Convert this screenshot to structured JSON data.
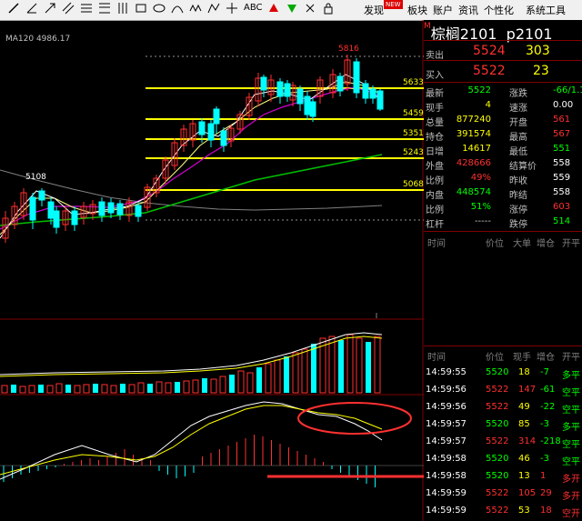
{
  "toolbar": {
    "text_tool": "ABC",
    "menu": [
      "发现",
      "板块",
      "账户",
      "资讯",
      "个性化",
      "系统工具"
    ],
    "new_badge": "NEW"
  },
  "chart": {
    "ma_label": "MA120  4986.17",
    "price_levels": [
      "5633",
      "5459",
      "5351",
      "5243",
      "5068"
    ],
    "peak_label": "5816",
    "left_label": "5108"
  },
  "quote": {
    "name": "棕榈2101",
    "code": "p2101",
    "m_mark": "M",
    "sell_label": "卖出",
    "sell_price": "5524",
    "sell_vol": "303",
    "buy_label": "买入",
    "buy_price": "5522",
    "buy_vol": "23",
    "stats_left": [
      {
        "label": "最新",
        "value": "5522",
        "color": "#00ff00"
      },
      {
        "label": "现手",
        "value": "4",
        "color": "#ffff00"
      },
      {
        "label": "总量",
        "value": "877240",
        "color": "#ffff00"
      },
      {
        "label": "持仓",
        "value": "391574",
        "color": "#ffff00"
      },
      {
        "label": "日增",
        "value": "14617",
        "color": "#ffff00"
      },
      {
        "label": "外盘",
        "value": "428666",
        "color": "#ff3030"
      },
      {
        "label": "比例",
        "value": "49%",
        "color": "#ff3030"
      },
      {
        "label": "内盘",
        "value": "448574",
        "color": "#00ff00"
      },
      {
        "label": "比例",
        "value": "51%",
        "color": "#00ff00"
      },
      {
        "label": "杠杆",
        "value": "-----",
        "color": "#c0c0c0"
      }
    ],
    "stats_right": [
      {
        "label": "涨跌",
        "value": "-66/1.18",
        "color": "#00ff00"
      },
      {
        "label": "速涨",
        "value": "0.00",
        "color": "#ffffff"
      },
      {
        "label": "开盘",
        "value": "561",
        "color": "#ff3030"
      },
      {
        "label": "最高",
        "value": "567",
        "color": "#ff3030"
      },
      {
        "label": "最低",
        "value": "551",
        "color": "#00ff00"
      },
      {
        "label": "结算价",
        "value": "558",
        "color": "#ffffff"
      },
      {
        "label": "昨收",
        "value": "559",
        "color": "#ffffff"
      },
      {
        "label": "昨结",
        "value": "558",
        "color": "#ffffff"
      },
      {
        "label": "涨停",
        "value": "603",
        "color": "#ff3030"
      },
      {
        "label": "跌停",
        "value": "514",
        "color": "#00ff00"
      }
    ]
  },
  "ticks_header1": {
    "time": "时间",
    "price": "价位",
    "big": "大单",
    "inc": "增仓",
    "open": "开平"
  },
  "ticks_header2": {
    "time": "时间",
    "price": "价位",
    "hand": "现手",
    "inc": "增仓",
    "open": "开平"
  },
  "ticks": [
    {
      "time": "14:59:55",
      "price": "5520",
      "hand": "18",
      "inc": "-7",
      "type": "多平"
    },
    {
      "time": "14:59:56",
      "price": "5522",
      "hand": "147",
      "inc": "-61",
      "type": "空平"
    },
    {
      "time": "14:59:56",
      "price": "5522",
      "hand": "49",
      "inc": "-22",
      "type": "空平"
    },
    {
      "time": "14:59:57",
      "price": "5520",
      "hand": "85",
      "inc": "-3",
      "type": "多平"
    },
    {
      "time": "14:59:57",
      "price": "5522",
      "hand": "314",
      "inc": "-218",
      "type": "空平"
    },
    {
      "time": "14:59:58",
      "price": "5520",
      "hand": "46",
      "inc": "-3",
      "type": "空平"
    },
    {
      "time": "14:59:58",
      "price": "5520",
      "hand": "13",
      "inc": "1",
      "type": "多开"
    },
    {
      "time": "14:59:59",
      "price": "5522",
      "hand": "105",
      "inc": "29",
      "type": "多开"
    },
    {
      "time": "14:59:59",
      "price": "5522",
      "hand": "53",
      "inc": "18",
      "type": "空开"
    }
  ]
}
